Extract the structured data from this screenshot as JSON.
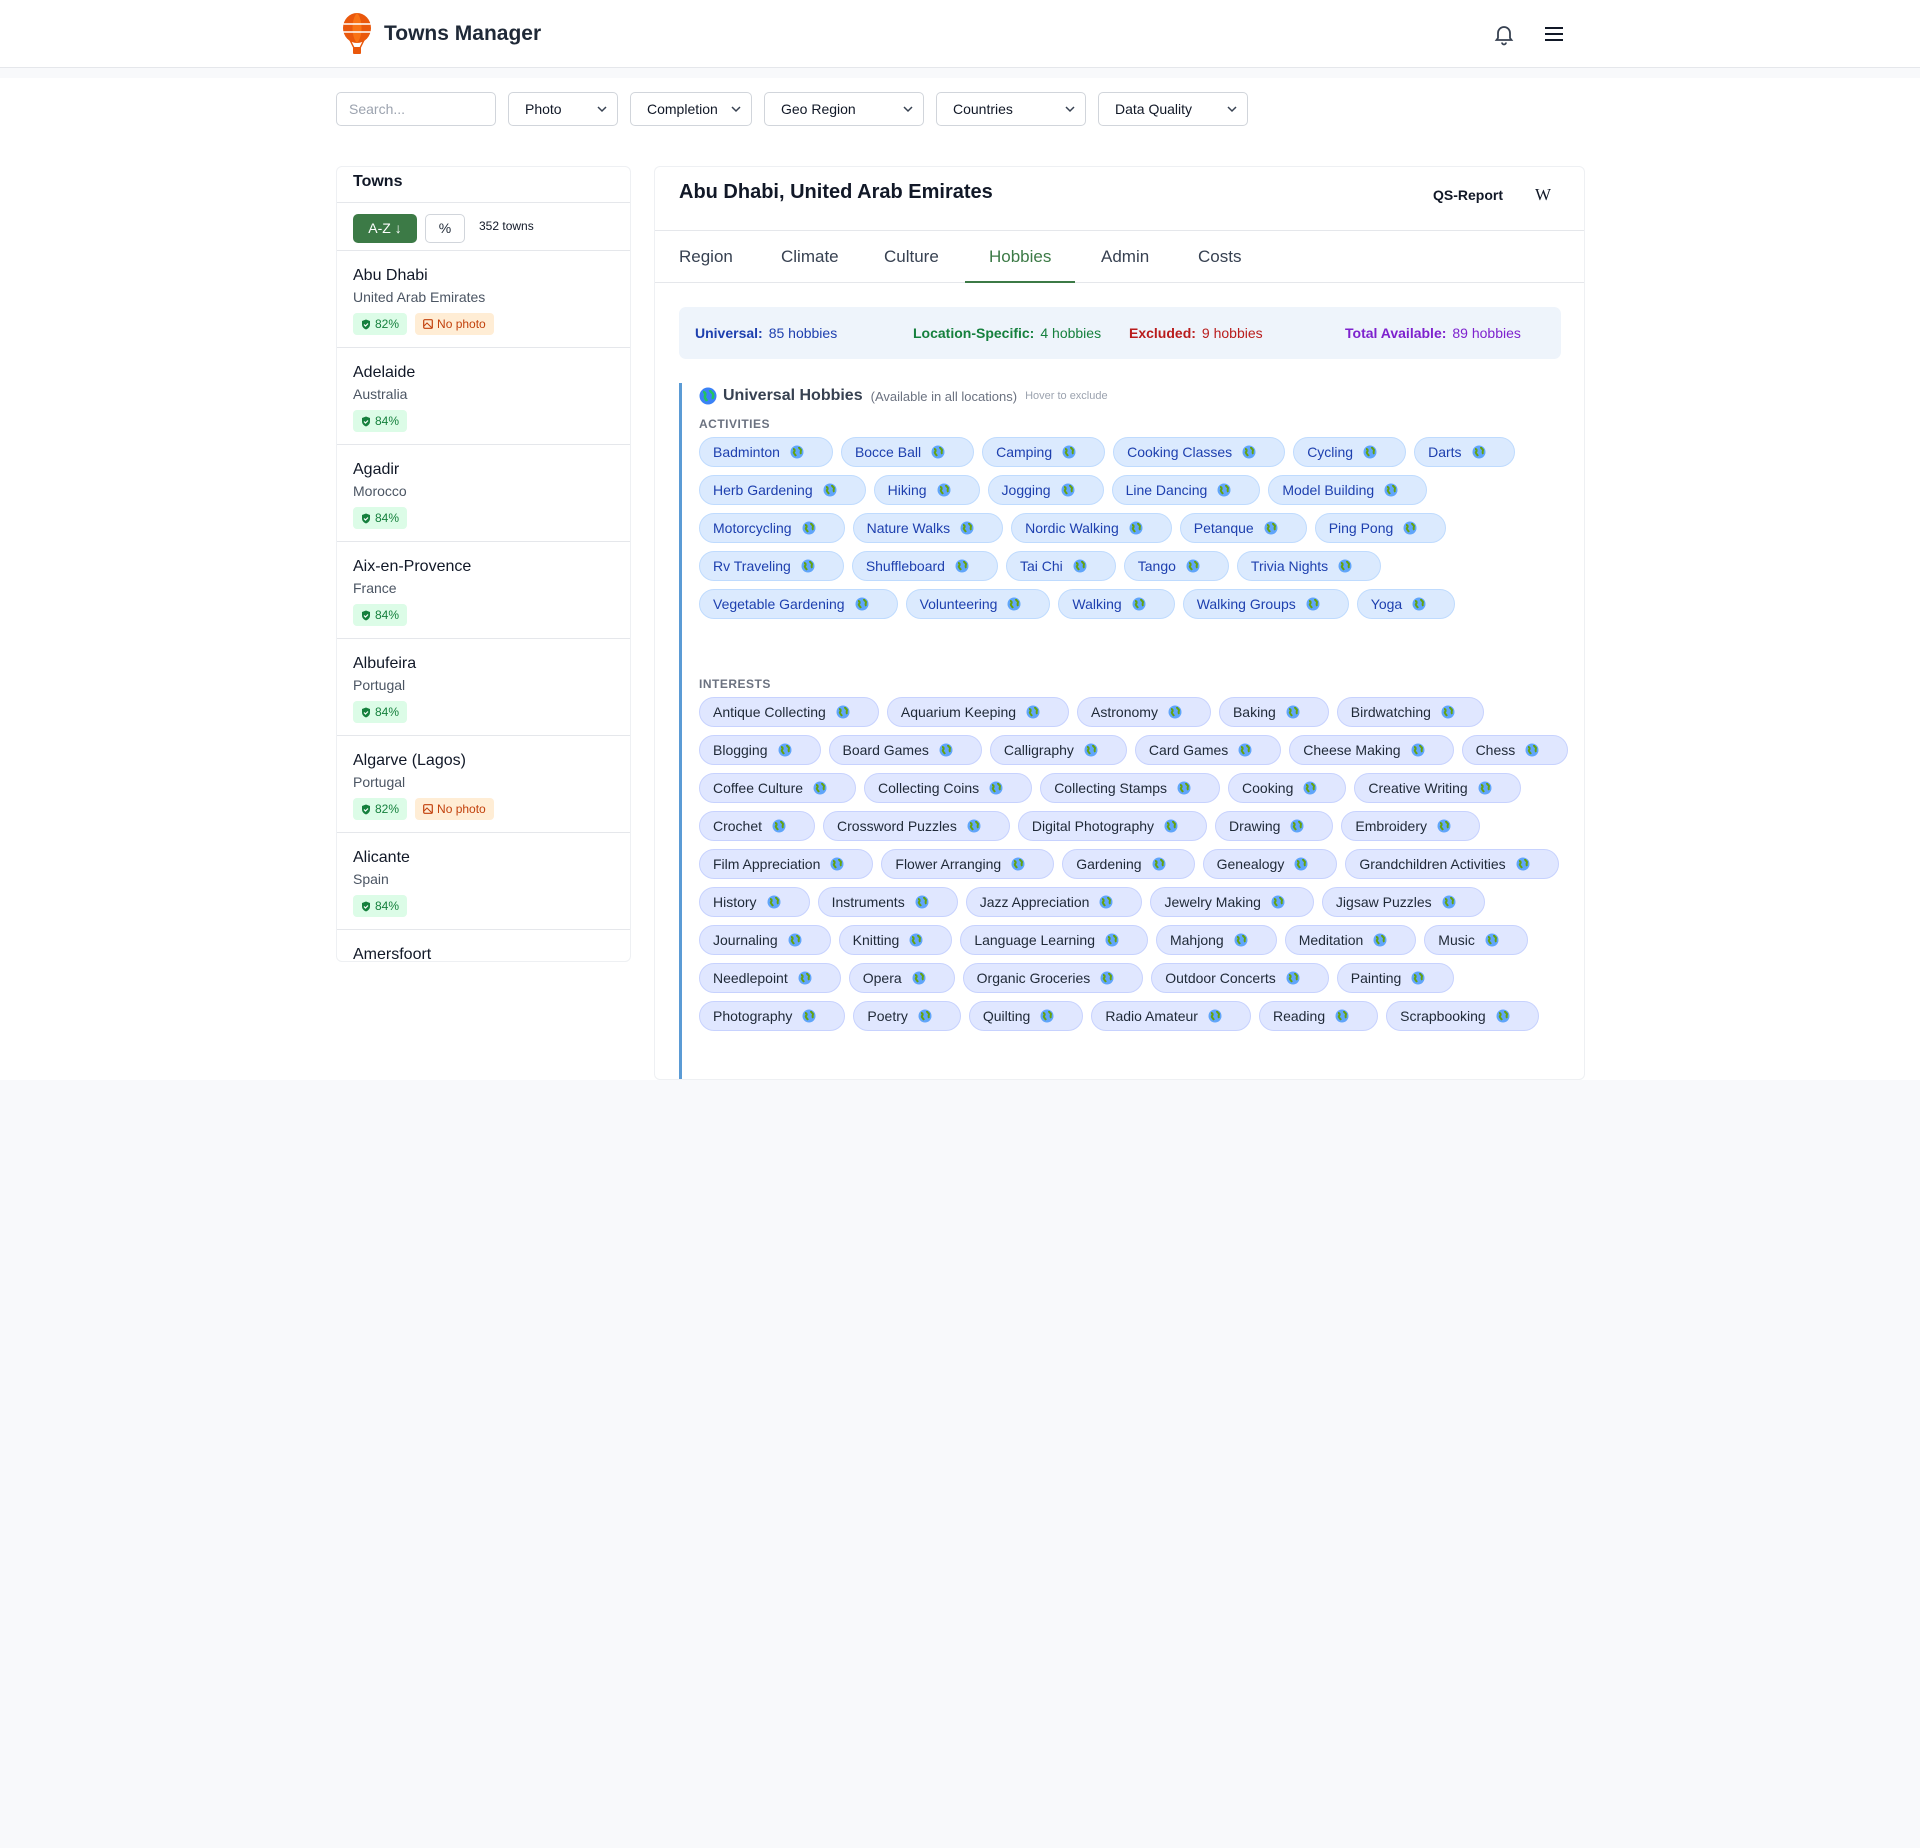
{
  "app": {
    "title": "Towns Manager"
  },
  "filters": {
    "search_placeholder": "Search...",
    "photo": "Photo",
    "completion": "Completion",
    "geo_region": "Geo Region",
    "countries": "Countries",
    "data_quality": "Data Quality"
  },
  "sidebar": {
    "title": "Towns",
    "sort_az": "A-Z ↓",
    "sort_pct": "%",
    "count": "352 towns",
    "towns": [
      {
        "name": "Abu Dhabi",
        "country": "United Arab Emirates",
        "pct": "82%",
        "no_photo": "No photo"
      },
      {
        "name": "Adelaide",
        "country": "Australia",
        "pct": "84%"
      },
      {
        "name": "Agadir",
        "country": "Morocco",
        "pct": "84%"
      },
      {
        "name": "Aix-en-Provence",
        "country": "France",
        "pct": "84%"
      },
      {
        "name": "Albufeira",
        "country": "Portugal",
        "pct": "84%"
      },
      {
        "name": "Algarve (Lagos)",
        "country": "Portugal",
        "pct": "82%",
        "no_photo": "No photo"
      },
      {
        "name": "Alicante",
        "country": "Spain",
        "pct": "84%"
      },
      {
        "name": "Amersfoort"
      }
    ]
  },
  "main": {
    "title": "Abu Dhabi, United Arab Emirates",
    "qs_report": "QS-Report",
    "wiki": "W",
    "tabs": [
      "Region",
      "Climate",
      "Culture",
      "Hobbies",
      "Admin",
      "Costs"
    ],
    "active_tab": "Hobbies",
    "summary": {
      "universal_label": "Universal:",
      "universal_value": "85 hobbies",
      "location_label": "Location-Specific:",
      "location_value": "4 hobbies",
      "excluded_label": "Excluded:",
      "excluded_value": "9 hobbies",
      "total_label": "Total Available:",
      "total_value": "89 hobbies"
    },
    "universal": {
      "title": "Universal Hobbies",
      "subtitle": "(Available in all locations)",
      "hint": "Hover to exclude",
      "activities_label": "ACTIVITIES",
      "activities": [
        "Badminton",
        "Bocce Ball",
        "Camping",
        "Cooking Classes",
        "Cycling",
        "Darts",
        "Herb Gardening",
        "Hiking",
        "Jogging",
        "Line Dancing",
        "Model Building",
        "Motorcycling",
        "Nature Walks",
        "Nordic Walking",
        "Petanque",
        "Ping Pong",
        "Rv Traveling",
        "Shuffleboard",
        "Tai Chi",
        "Tango",
        "Trivia Nights",
        "Vegetable Gardening",
        "Volunteering",
        "Walking",
        "Walking Groups",
        "Yoga"
      ],
      "interests_label": "INTERESTS",
      "interests": [
        "Antique Collecting",
        "Aquarium Keeping",
        "Astronomy",
        "Baking",
        "Birdwatching",
        "Blogging",
        "Board Games",
        "Calligraphy",
        "Card Games",
        "Cheese Making",
        "Chess",
        "Coffee Culture",
        "Collecting Coins",
        "Collecting Stamps",
        "Cooking",
        "Creative Writing",
        "Crochet",
        "Crossword Puzzles",
        "Digital Photography",
        "Drawing",
        "Embroidery",
        "Film Appreciation",
        "Flower Arranging",
        "Gardening",
        "Genealogy",
        "Grandchildren Activities",
        "History",
        "Instruments",
        "Jazz Appreciation",
        "Jewelry Making",
        "Jigsaw Puzzles",
        "Journaling",
        "Knitting",
        "Language Learning",
        "Mahjong",
        "Meditation",
        "Music",
        "Needlepoint",
        "Opera",
        "Organic Groceries",
        "Outdoor Concerts",
        "Painting",
        "Photography",
        "Poetry",
        "Quilting",
        "Radio Amateur",
        "Reading",
        "Scrapbooking"
      ]
    }
  },
  "colors": {
    "accent": "#3c7a46",
    "universal": "#1e40af",
    "location": "#15803d",
    "excluded": "#b91c1c",
    "total": "#7e22ce"
  }
}
